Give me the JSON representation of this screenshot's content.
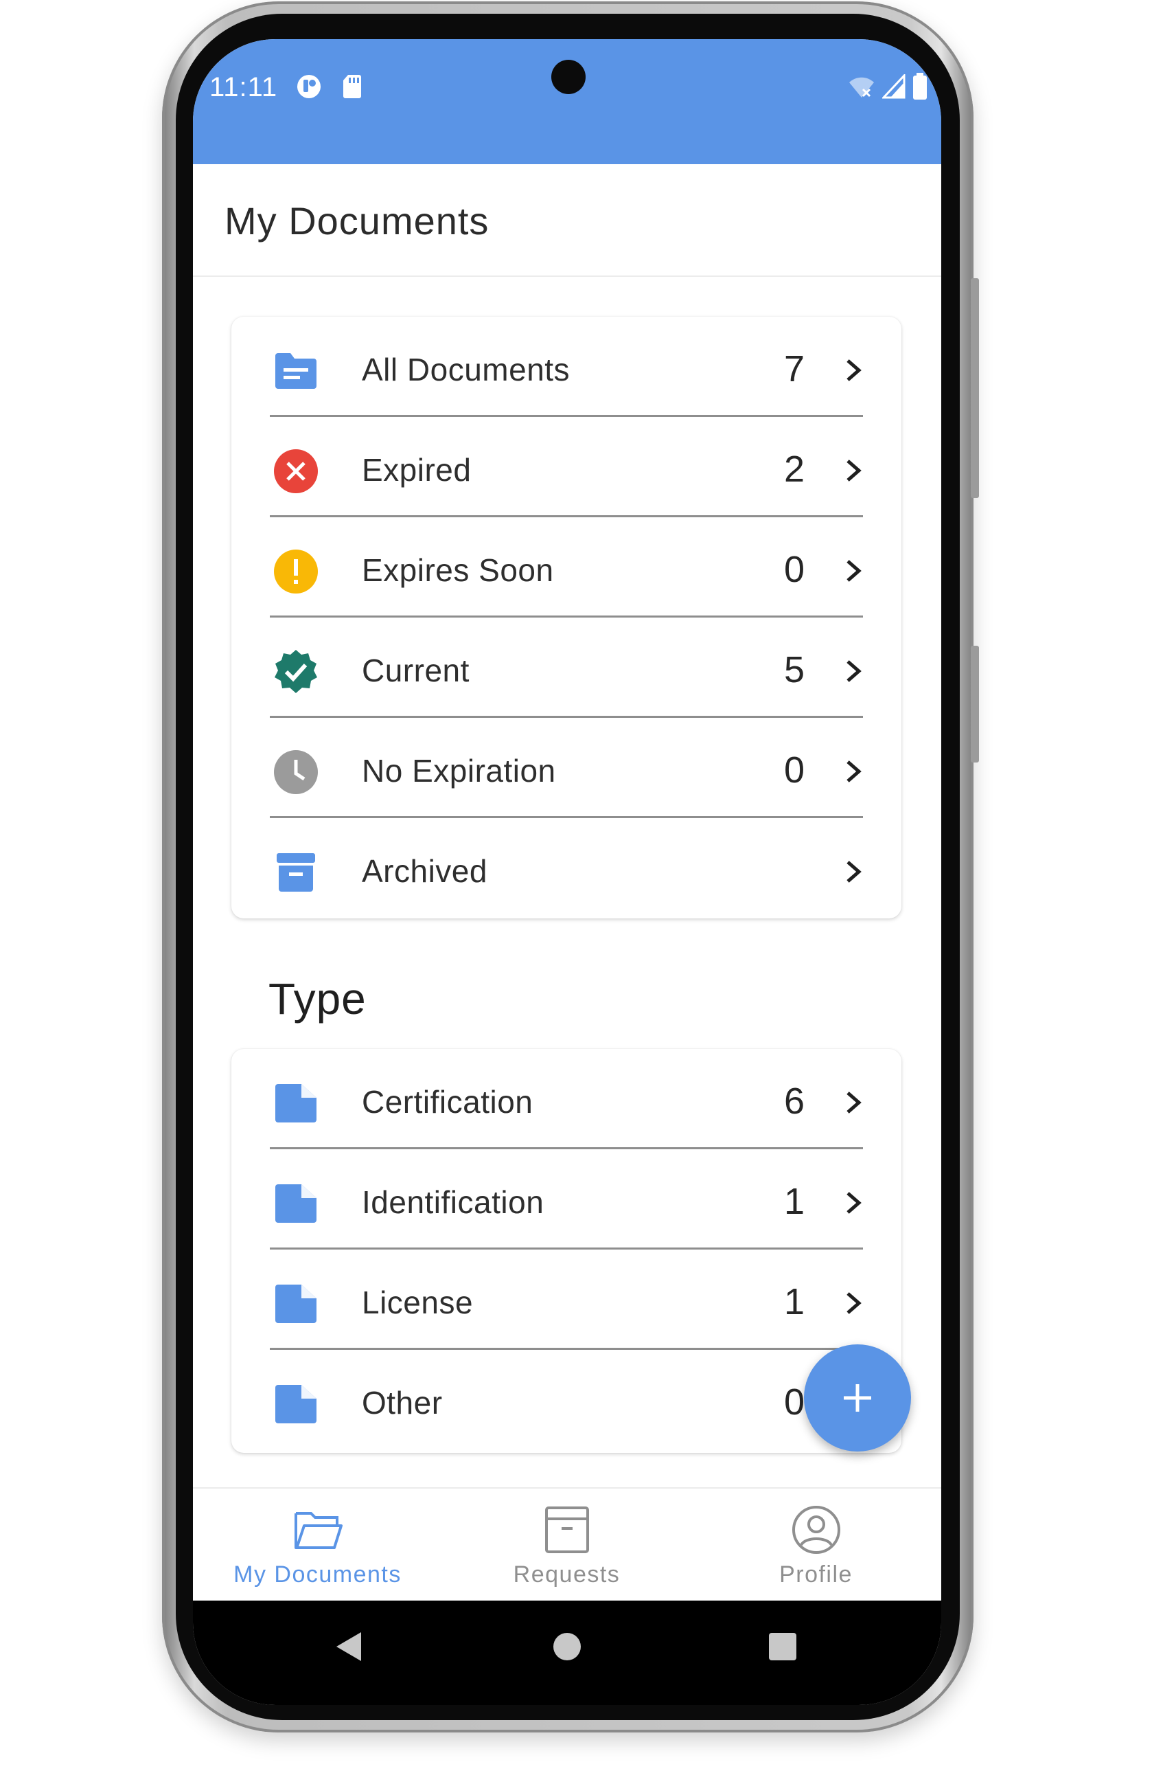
{
  "status_bar": {
    "time": "11:11",
    "background_color": "#5a94e6",
    "left_icons": [
      "app-notification-icon",
      "sd-card-icon"
    ],
    "right_icons": [
      "wifi-off-icon",
      "cell-signal-icon",
      "battery-icon"
    ]
  },
  "app_bar": {
    "title": "My Documents"
  },
  "status_list": {
    "items": [
      {
        "label": "All Documents",
        "count": "7",
        "icon": "folder-icon"
      },
      {
        "label": "Expired",
        "count": "2",
        "icon": "expired-icon"
      },
      {
        "label": "Expires Soon",
        "count": "0",
        "icon": "warning-icon"
      },
      {
        "label": "Current",
        "count": "5",
        "icon": "verified-icon"
      },
      {
        "label": "No Expiration",
        "count": "0",
        "icon": "clock-icon"
      },
      {
        "label": "Archived",
        "count": "",
        "icon": "archive-icon"
      }
    ]
  },
  "type_section": {
    "title": "Type",
    "items": [
      {
        "label": "Certification",
        "count": "6",
        "icon": "document-icon"
      },
      {
        "label": "Identification",
        "count": "1",
        "icon": "document-icon"
      },
      {
        "label": "License",
        "count": "1",
        "icon": "document-icon"
      },
      {
        "label": "Other",
        "count": "0",
        "icon": "document-icon"
      }
    ]
  },
  "fab": {
    "icon": "plus-icon"
  },
  "bottom_nav": {
    "items": [
      {
        "label": "My Documents",
        "icon": "folder-open-icon",
        "active": true
      },
      {
        "label": "Requests",
        "icon": "inbox-icon",
        "active": false
      },
      {
        "label": "Profile",
        "icon": "profile-icon",
        "active": false
      }
    ]
  },
  "system_nav": {
    "buttons": [
      "back-icon",
      "home-icon",
      "recents-icon"
    ]
  },
  "colors": {
    "accent": "#5a94e6",
    "expired": "#e8443a",
    "warning": "#f9b806",
    "current": "#1e7a6a",
    "neutral": "#9b9b9b"
  }
}
